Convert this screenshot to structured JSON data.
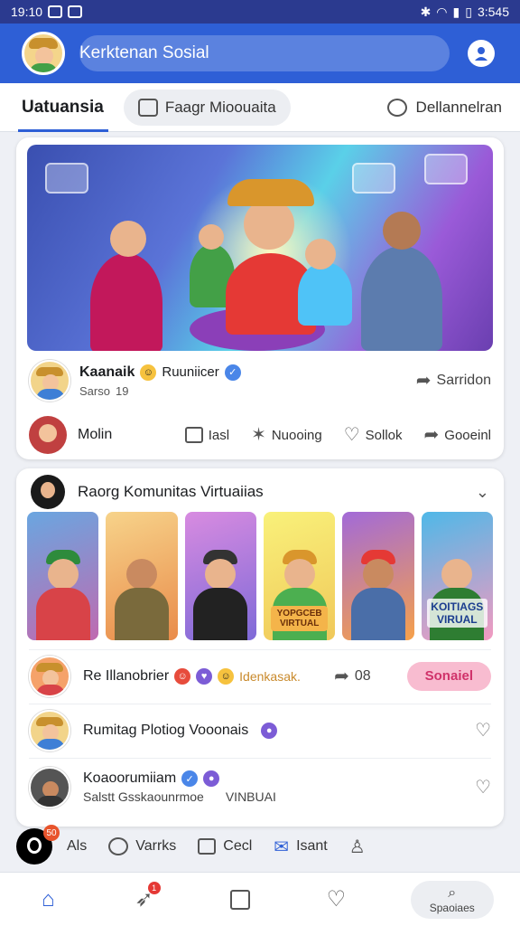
{
  "status_bar": {
    "time": "19:10",
    "right_time": "3:545"
  },
  "header": {
    "title": "Kerktenan Sosial"
  },
  "tabs": {
    "active": "Uatuansia",
    "pill": "Faagr Mioouaita",
    "right": "Dellannelran"
  },
  "post": {
    "author": "Kaanaik",
    "author_extra": "Ruuniicer",
    "meta": "Sarso",
    "meta_count": "19",
    "share_label": "Sarridon",
    "comment_author": "Molin",
    "actions": [
      {
        "label": "Iasl",
        "icon": "comment-icon"
      },
      {
        "label": "Nuooing",
        "icon": "sparkle-icon"
      },
      {
        "label": "Sollok",
        "icon": "heart-icon"
      },
      {
        "label": "Gooeinl",
        "icon": "share-icon"
      }
    ]
  },
  "community": {
    "title": "Raorg Komunitas Virtuaiias",
    "thumb_labels": [
      "YOPGCEB VIRTUAL",
      "KOITIAGS VIRUAL"
    ],
    "rows": [
      {
        "name": "Re Illanobrier",
        "tag": "Idenkasak.",
        "count": "08",
        "button": "Sonaiel"
      },
      {
        "name": "Rumitag Plotiog Vooonais"
      },
      {
        "name": "Koaoorumiiam",
        "sub": "Salstt Gsskaounrmoe",
        "sub_right": "VINBUAI"
      }
    ]
  },
  "bottom_strip": {
    "badge": "50",
    "items": [
      "Als",
      "Varrks",
      "Cecl",
      "Isant"
    ]
  },
  "bottom_nav": {
    "search_label": "Spaoiaes",
    "badge": "1"
  }
}
